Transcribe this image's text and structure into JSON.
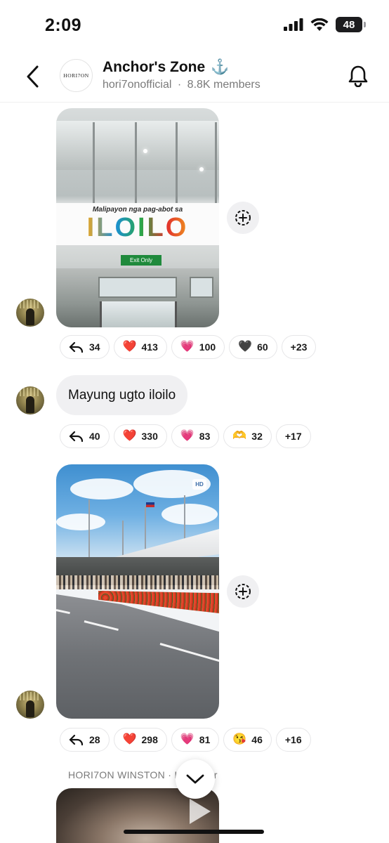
{
  "status_bar": {
    "time": "2:09",
    "battery": "48"
  },
  "header": {
    "avatar_text": "HORI7ON",
    "title": "Anchor's Zone",
    "title_emoji": "⚓",
    "handle": "hori7onofficial",
    "separator": "·",
    "members": "8.8K members"
  },
  "messages": [
    {
      "type": "image",
      "image_text": {
        "banner_top": "Malipayon nga pag-abot sa",
        "banner_main": "ILOILO",
        "exit_sign": "Exit Only"
      },
      "reactions": [
        {
          "icon": "reply-icon",
          "count": "34"
        },
        {
          "emoji": "❤️",
          "count": "413"
        },
        {
          "emoji": "💗",
          "count": "100"
        },
        {
          "emoji": "🖤",
          "count": "60"
        },
        {
          "count": "+23"
        }
      ]
    },
    {
      "type": "text",
      "text": "Mayung ugto iloilo",
      "reactions": [
        {
          "icon": "reply-icon",
          "count": "40"
        },
        {
          "emoji": "❤️",
          "count": "330"
        },
        {
          "emoji": "💗",
          "count": "83"
        },
        {
          "emoji": "🫶",
          "count": "32"
        },
        {
          "count": "+17"
        }
      ]
    },
    {
      "type": "image",
      "badge": "HD",
      "reactions": [
        {
          "icon": "reply-icon",
          "count": "28"
        },
        {
          "emoji": "❤️",
          "count": "298"
        },
        {
          "emoji": "💗",
          "count": "81"
        },
        {
          "emoji": "😘",
          "count": "46"
        },
        {
          "count": "+16"
        }
      ]
    }
  ],
  "next_message": {
    "author": "HORI7ON WINSTON",
    "separator": "·",
    "role_fragment_left": "I",
    "role_fragment_right": "or"
  },
  "colors": {
    "chip_border": "#e6e6e8",
    "bubble_bg": "#f0f0f2",
    "subtext": "#7a7a7a"
  }
}
